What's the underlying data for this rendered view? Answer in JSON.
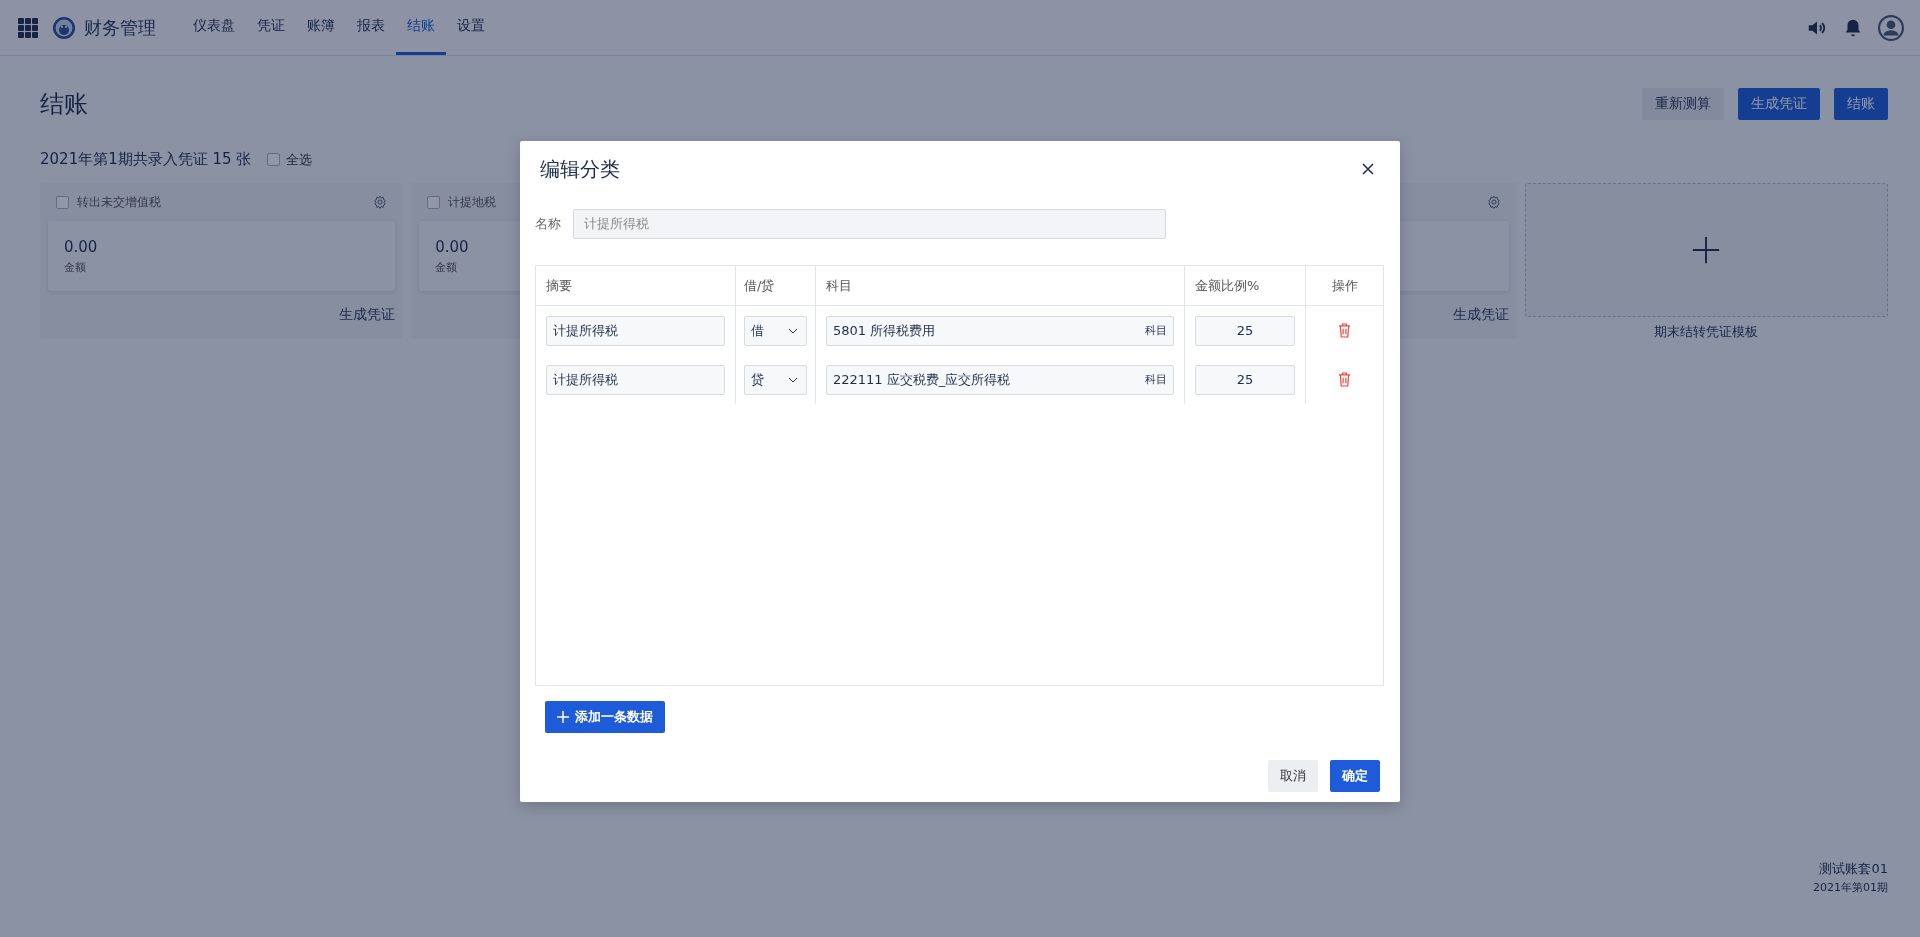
{
  "nav": {
    "brand": "财务管理",
    "items": [
      {
        "label": "仪表盘",
        "selected": false
      },
      {
        "label": "凭证",
        "selected": false
      },
      {
        "label": "账簿",
        "selected": false
      },
      {
        "label": "报表",
        "selected": false
      },
      {
        "label": "结账",
        "selected": true
      },
      {
        "label": "设置",
        "selected": false
      }
    ]
  },
  "page": {
    "title": "结账",
    "actions": [
      {
        "label": "重新测算",
        "kind": "secondary"
      },
      {
        "label": "生成凭证",
        "kind": "primary"
      },
      {
        "label": "结账",
        "kind": "primary"
      }
    ],
    "summary": "2021年第1期共录入凭证 15 张",
    "select_all": {
      "label": "全选",
      "checked": false
    }
  },
  "cards": [
    {
      "title": "转出未交增值税",
      "checked": false,
      "amount": "0.00",
      "amount_label": "金额",
      "action": "生成凭证"
    },
    {
      "title": "计提地税",
      "checked": false,
      "amount": "0.00",
      "amount_label": "金额"
    },
    {
      "action": "生成凭证"
    }
  ],
  "add_card": {
    "label": "期末结转凭证模板"
  },
  "footer": {
    "account": "测试账套01",
    "period": "2021年第01期"
  },
  "dialog": {
    "title": "编辑分类",
    "name_label": "名称",
    "name_value": "计提所得税",
    "columns": [
      "摘要",
      "借/贷",
      "科目",
      "金额比例%",
      "操作"
    ],
    "rows": [
      {
        "summary": "计提所得税",
        "direction": "借",
        "subject": "5801 所得税费用",
        "subject_suffix": "科目",
        "ratio": "25"
      },
      {
        "summary": "计提所得税",
        "direction": "贷",
        "subject": "222111 应交税费_应交所得税",
        "subject_suffix": "科目",
        "ratio": "25"
      }
    ],
    "add_button": "添加一条数据",
    "cancel": "取消",
    "ok": "确定"
  }
}
